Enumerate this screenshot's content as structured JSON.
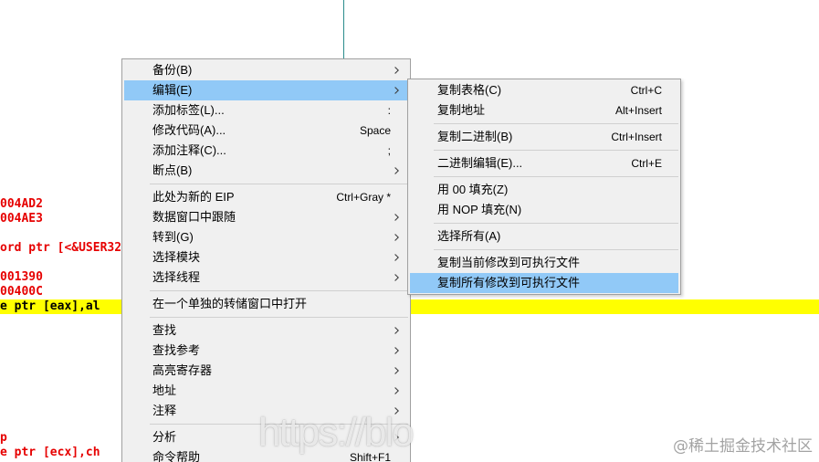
{
  "disassembly": {
    "lines": [
      {
        "text": "004AD2"
      },
      {
        "text": "004AE3"
      },
      {
        "text": "ord ptr [<&USER32"
      },
      {
        "text": "001390"
      },
      {
        "text": "00400C"
      },
      {
        "text": "e ptr [eax],al",
        "highlighted": true
      },
      {
        "text": "p"
      },
      {
        "text": "e ptr [ecx],ch"
      }
    ]
  },
  "context_menu": {
    "groups": [
      [
        {
          "label": "备份(B)",
          "icon": "chevron-right-icon"
        },
        {
          "label": "编辑(E)",
          "icon": "chevron-right-icon",
          "highlighted": true
        },
        {
          "label": "添加标签(L)...",
          "shortcut": ":"
        },
        {
          "label": "修改代码(A)...",
          "shortcut": "Space"
        },
        {
          "label": "添加注释(C)...",
          "shortcut": ";"
        },
        {
          "label": "断点(B)",
          "icon": "chevron-right-icon"
        }
      ],
      [
        {
          "label": "此处为新的 EIP",
          "shortcut": "Ctrl+Gray *"
        },
        {
          "label": "数据窗口中跟随",
          "icon": "chevron-right-icon"
        },
        {
          "label": "转到(G)",
          "icon": "chevron-right-icon"
        },
        {
          "label": "选择模块",
          "icon": "chevron-right-icon"
        },
        {
          "label": "选择线程",
          "icon": "chevron-right-icon"
        }
      ],
      [
        {
          "label": "在一个单独的转储窗口中打开"
        }
      ],
      [
        {
          "label": "查找",
          "icon": "chevron-right-icon"
        },
        {
          "label": "查找参考",
          "icon": "chevron-right-icon"
        },
        {
          "label": "高亮寄存器",
          "icon": "chevron-right-icon"
        },
        {
          "label": "地址",
          "icon": "chevron-right-icon"
        },
        {
          "label": "注释",
          "icon": "chevron-right-icon"
        }
      ],
      [
        {
          "label": "分析",
          "icon": "chevron-right-icon"
        },
        {
          "label": "命令帮助",
          "shortcut": "Shift+F1"
        }
      ]
    ]
  },
  "edit_submenu": {
    "groups": [
      [
        {
          "label": "复制表格(C)",
          "shortcut": "Ctrl+C"
        },
        {
          "label": "复制地址",
          "shortcut": "Alt+Insert"
        }
      ],
      [
        {
          "label": "复制二进制(B)",
          "shortcut": "Ctrl+Insert"
        }
      ],
      [
        {
          "label": "二进制编辑(E)...",
          "shortcut": "Ctrl+E"
        }
      ],
      [
        {
          "label": "用 00 填充(Z)"
        },
        {
          "label": "用 NOP 填充(N)"
        }
      ],
      [
        {
          "label": "选择所有(A)"
        }
      ],
      [
        {
          "label": "复制当前修改到可执行文件"
        },
        {
          "label": "复制所有修改到可执行文件",
          "highlighted": true
        }
      ]
    ]
  },
  "watermark": {
    "url_text": "https://blo",
    "credit_text": "@稀土掘金技术社区"
  },
  "colors": {
    "address_text": "#e60000",
    "selected_line_text": "#000000",
    "selected_line_bg": "#ffff00",
    "graph_line": "#2a8c8c",
    "menu_bg": "#f0f0f0",
    "menu_border": "#a0a0a0",
    "menu_highlight": "#91c9f7",
    "separator": "#d0d0d0"
  }
}
